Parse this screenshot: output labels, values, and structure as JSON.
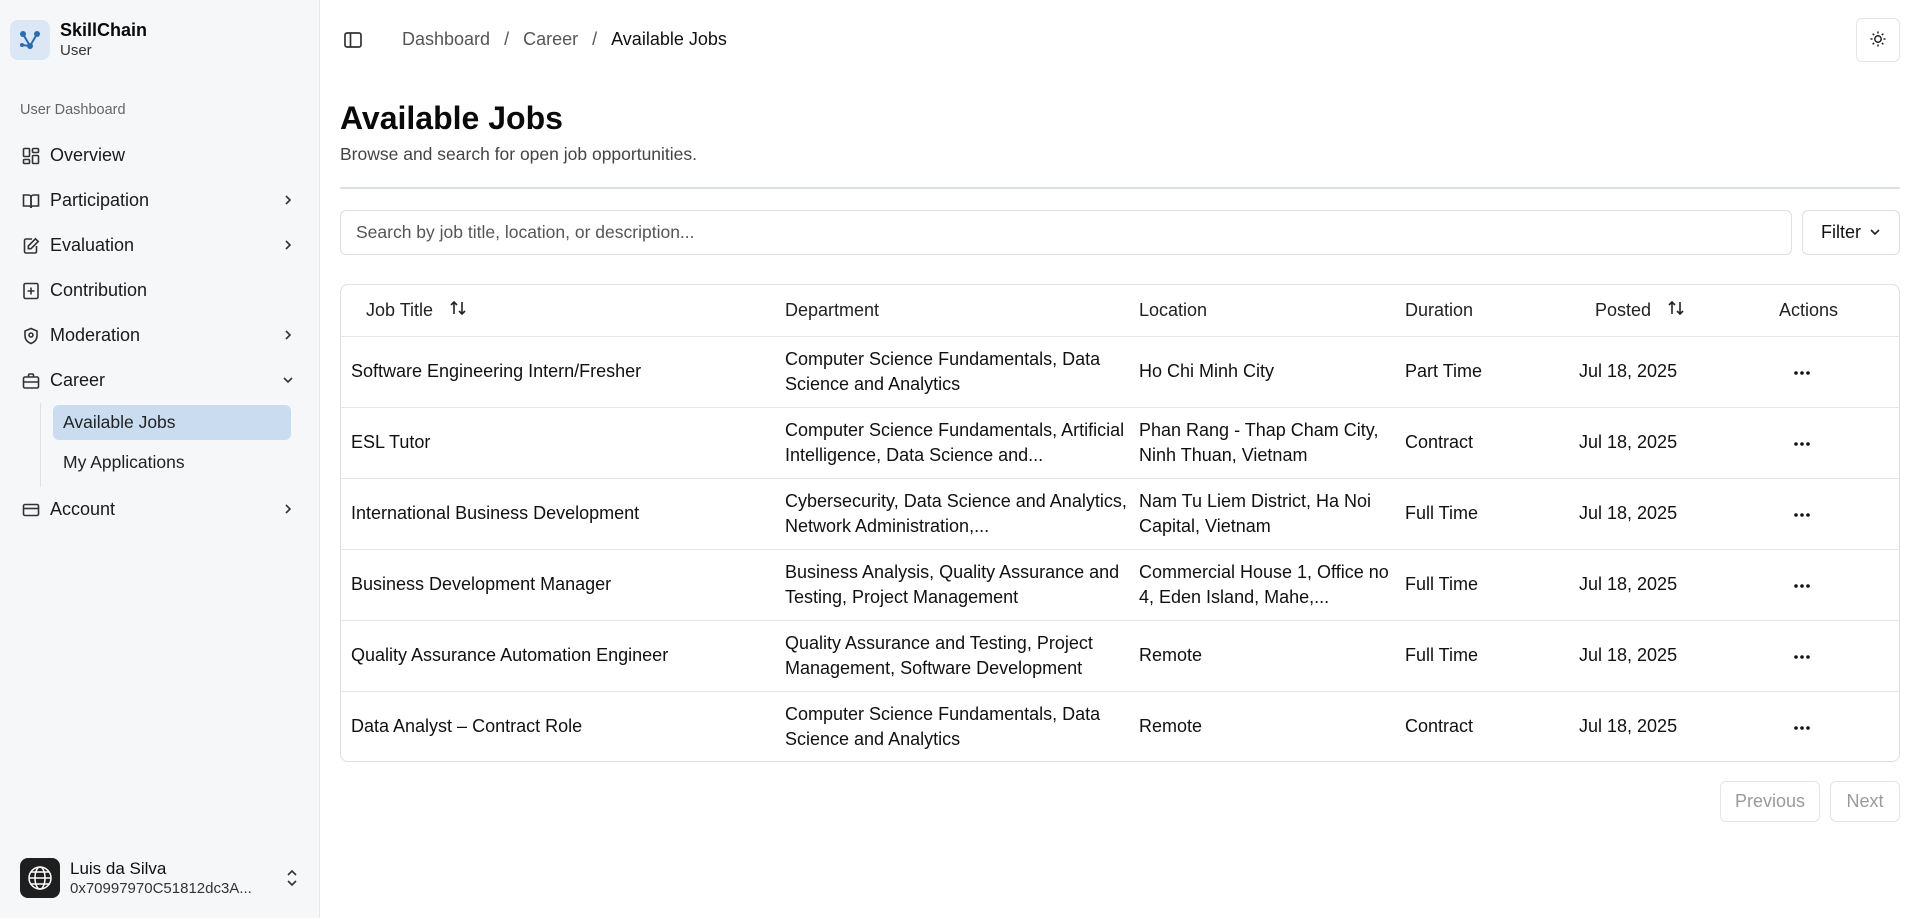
{
  "brand": {
    "name": "SkillChain",
    "role": "User"
  },
  "sidebar": {
    "group_label": "User Dashboard",
    "items": [
      {
        "label": "Overview",
        "icon": "dashboard-icon",
        "has_children": false
      },
      {
        "label": "Participation",
        "icon": "book-open-icon",
        "has_children": true
      },
      {
        "label": "Evaluation",
        "icon": "edit-note-icon",
        "has_children": true
      },
      {
        "label": "Contribution",
        "icon": "plus-square-icon",
        "has_children": false
      },
      {
        "label": "Moderation",
        "icon": "shield-icon",
        "has_children": true
      },
      {
        "label": "Career",
        "icon": "briefcase-icon",
        "has_children": true,
        "expanded": true,
        "children": [
          {
            "label": "Available Jobs",
            "active": true
          },
          {
            "label": "My Applications",
            "active": false
          }
        ]
      },
      {
        "label": "Account",
        "icon": "credit-card-icon",
        "has_children": true
      }
    ]
  },
  "user": {
    "name": "Luis da Silva",
    "address": "0x70997970C51812dc3A..."
  },
  "breadcrumb": {
    "items": [
      "Dashboard",
      "Career",
      "Available Jobs"
    ],
    "separator": "/"
  },
  "page": {
    "title": "Available Jobs",
    "description": "Browse and search for open job opportunities."
  },
  "search": {
    "placeholder": "Search by job title, location, or description...",
    "value": ""
  },
  "filter": {
    "label": "Filter"
  },
  "table": {
    "headers": {
      "title": "Job Title",
      "department": "Department",
      "location": "Location",
      "duration": "Duration",
      "posted": "Posted",
      "actions": "Actions"
    },
    "rows": [
      {
        "title": "Software Engineering Intern/Fresher",
        "department": "Computer Science Fundamentals, Data Science and Analytics",
        "location": "Ho Chi Minh City",
        "duration": "Part Time",
        "posted": "Jul 18, 2025"
      },
      {
        "title": "ESL Tutor",
        "department": "Computer Science Fundamentals, Artificial Intelligence, Data Science and...",
        "location": "Phan Rang - Thap Cham City, Ninh Thuan, Vietnam",
        "duration": "Contract",
        "posted": "Jul 18, 2025"
      },
      {
        "title": "International Business Development",
        "department": "Cybersecurity, Data Science and Analytics, Network Administration,...",
        "location": "Nam Tu Liem District, Ha Noi Capital, Vietnam",
        "duration": "Full Time",
        "posted": "Jul 18, 2025"
      },
      {
        "title": "Business Development Manager",
        "department": "Business Analysis, Quality Assurance and Testing, Project Management",
        "location": "Commercial House 1, Office no 4, Eden Island, Mahe,...",
        "duration": "Full Time",
        "posted": "Jul 18, 2025"
      },
      {
        "title": "Quality Assurance Automation Engineer",
        "department": "Quality Assurance and Testing, Project Management, Software Development",
        "location": "Remote",
        "duration": "Full Time",
        "posted": "Jul 18, 2025"
      },
      {
        "title": "Data Analyst – Contract Role",
        "department": "Computer Science Fundamentals, Data Science and Analytics",
        "location": "Remote",
        "duration": "Contract",
        "posted": "Jul 18, 2025"
      }
    ]
  },
  "pagination": {
    "previous": "Previous",
    "next": "Next"
  },
  "colors": {
    "accent": "#2b6cb0",
    "active_bg": "#c9dcf0",
    "sidebar_bg": "#f5f7f9"
  }
}
